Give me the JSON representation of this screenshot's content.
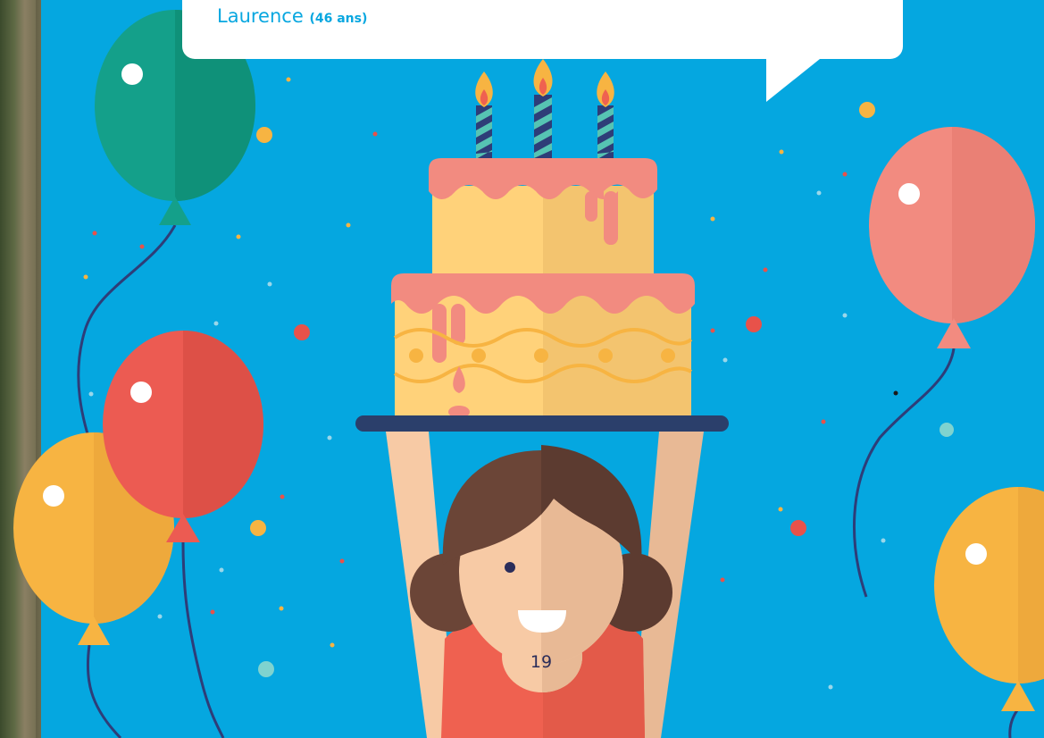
{
  "speech_bubble": {
    "name": "Laurence",
    "age": "(46 ans)"
  },
  "page_number": "19",
  "colors": {
    "background": "#05a7e0",
    "bubble": "#ffffff",
    "name_text": "#08a7e0",
    "balloon_green": "#14a08a",
    "balloon_red": "#ea5a4f",
    "balloon_yellow": "#f7b442",
    "balloon_pink": "#f28b80",
    "cake_frosting": "#f28b80",
    "cake_sponge": "#ffd27a",
    "tray": "#2b3f6b",
    "hair": "#6b4537",
    "dress": "#ef6150",
    "skin": "#f7caa5"
  },
  "icons": [
    "birthday-cake-icon",
    "candle-icon",
    "balloon-icon",
    "confetti-icon",
    "girl-illustration"
  ]
}
